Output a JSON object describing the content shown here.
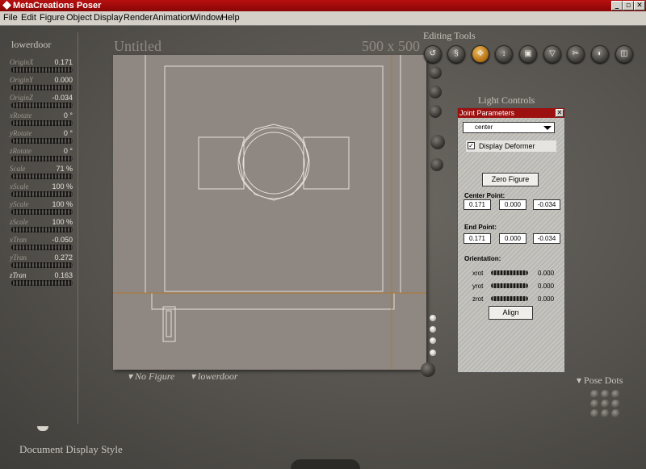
{
  "app": {
    "title": "MetaCreations Poser"
  },
  "window_buttons": {
    "minimize": "_",
    "restore": "▫",
    "close": "✕"
  },
  "menu": [
    "File",
    "Edit",
    "Figure",
    "Object",
    "Display",
    "Render",
    "Animation",
    "Window",
    "Help"
  ],
  "params": {
    "title": "lowerdoor",
    "items": [
      {
        "label": "OriginX",
        "value": "0.171"
      },
      {
        "label": "OriginY",
        "value": "0.000"
      },
      {
        "label": "OriginZ",
        "value": "-0.034"
      },
      {
        "label": "xRotate",
        "value": "0 °"
      },
      {
        "label": "yRotate",
        "value": "0 °"
      },
      {
        "label": "zRotate",
        "value": "0 °"
      },
      {
        "label": "Scale",
        "value": "71 %"
      },
      {
        "label": "xScale",
        "value": "100 %"
      },
      {
        "label": "yScale",
        "value": "100 %"
      },
      {
        "label": "zScale",
        "value": "100 %"
      },
      {
        "label": "xTran",
        "value": "-0.050"
      },
      {
        "label": "yTran",
        "value": "0.272"
      },
      {
        "label": "zTran",
        "value": "0.163"
      }
    ]
  },
  "document": {
    "title": "Untitled",
    "size": "500 x 500",
    "figure_menu": "No Figure",
    "actor_menu": "lowerdoor"
  },
  "labels": {
    "editing_tools": "Editing Tools",
    "light_controls": "Light Controls",
    "pose_dots": "Pose Dots",
    "display_style": "Document Display Style"
  },
  "joint": {
    "title": "Joint Parameters",
    "close": "✕",
    "dropdown": "center",
    "display_deformer": "Display Deformer",
    "display_deformer_checked": true,
    "check_mark": "✓",
    "zero_figure": "Zero Figure",
    "center_point_label": "Center Point:",
    "center_point": [
      "0.171",
      "0.000",
      "-0.034"
    ],
    "end_point_label": "End Point:",
    "end_point": [
      "0.171",
      "0.000",
      "-0.034"
    ],
    "orientation_label": "Orientation:",
    "rotations": [
      {
        "label": "xrot",
        "value": "0.000"
      },
      {
        "label": "yrot",
        "value": "0.000"
      },
      {
        "label": "zrot",
        "value": "0.000"
      }
    ],
    "align": "Align"
  }
}
